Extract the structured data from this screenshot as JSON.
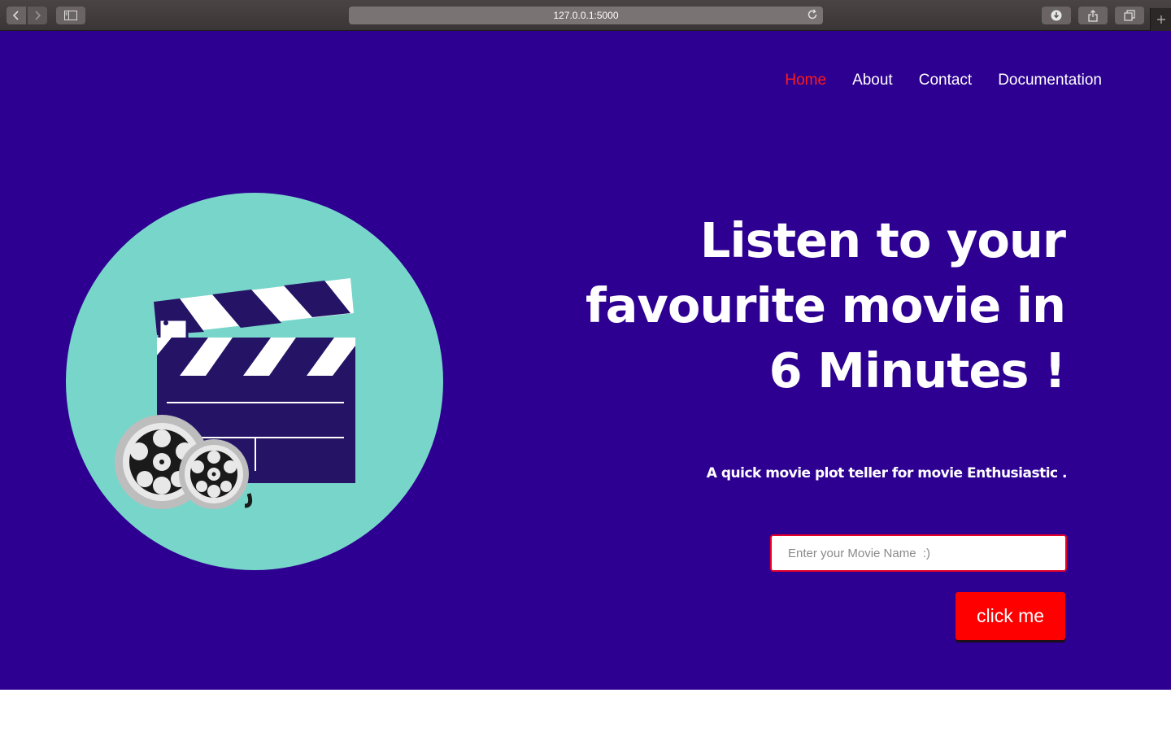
{
  "browser": {
    "url": "127.0.0.1:5000",
    "icons": [
      "back-arrow-icon",
      "forward-arrow-icon",
      "sidebar-icon",
      "reload-icon",
      "download-icon",
      "share-icon",
      "tabs-icon",
      "new-tab-icon"
    ]
  },
  "nav": {
    "items": [
      {
        "label": "Home",
        "active": true
      },
      {
        "label": "About",
        "active": false
      },
      {
        "label": "Contact",
        "active": false
      },
      {
        "label": "Documentation",
        "active": false
      }
    ]
  },
  "hero": {
    "headline_line1": "Listen to your",
    "headline_line2": "favourite movie in",
    "headline_line3": "6 Minutes !",
    "tagline": "A quick movie plot teller for movie Enthusiastic .",
    "illustration": "clapperboard-and-film-reels-illustration"
  },
  "search": {
    "placeholder": "Enter your Movie Name  :)",
    "value": ""
  },
  "submit": {
    "label": "click me"
  },
  "colors": {
    "page_background": "#2d0091",
    "circle": "#78d5ca",
    "accent_red": "#ff0000",
    "active_nav": "#ff1a1a",
    "text": "#ffffff"
  }
}
